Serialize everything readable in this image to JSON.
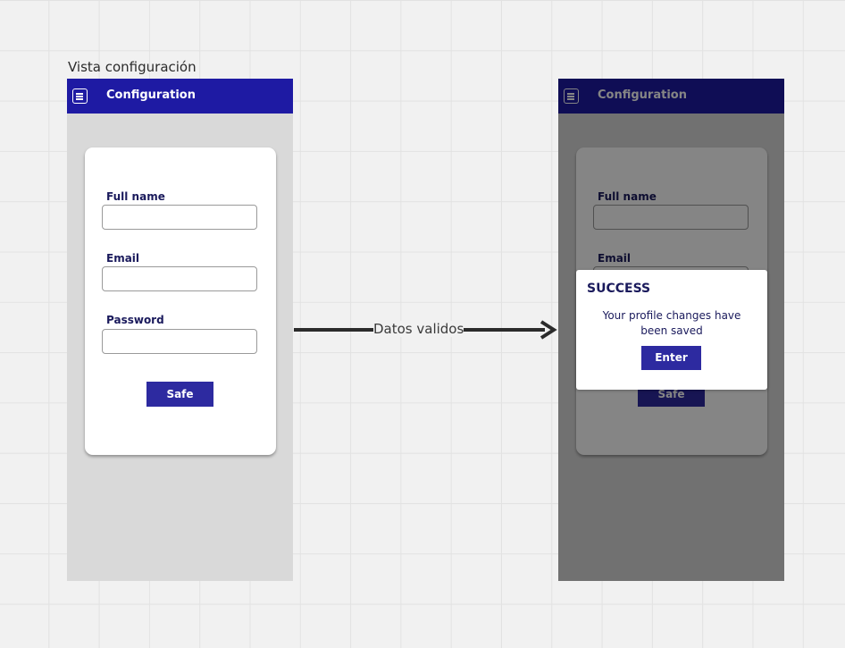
{
  "frame_title": "Vista configuración",
  "connector_label": "Datos validos",
  "colors": {
    "appbar": "#1e1aa3",
    "button": "#2d2aa0",
    "label_text": "#1a1a5c"
  },
  "left_screen": {
    "appbar": {
      "menu_icon": "hamburger-menu-icon",
      "title": "Configuration"
    },
    "form": {
      "full_name_label": "Full name",
      "full_name_value": "",
      "email_label": "Email",
      "email_value": "",
      "password_label": "Password",
      "password_value": "",
      "submit_label": "Safe"
    }
  },
  "right_screen": {
    "appbar": {
      "menu_icon": "hamburger-menu-icon",
      "title": "Configuration"
    },
    "form": {
      "full_name_label": "Full name",
      "email_label": "Email",
      "submit_label": "Safe"
    },
    "dialog": {
      "title": "SUCCESS",
      "message": "Your profile changes have been saved",
      "button_label": "Enter"
    }
  }
}
